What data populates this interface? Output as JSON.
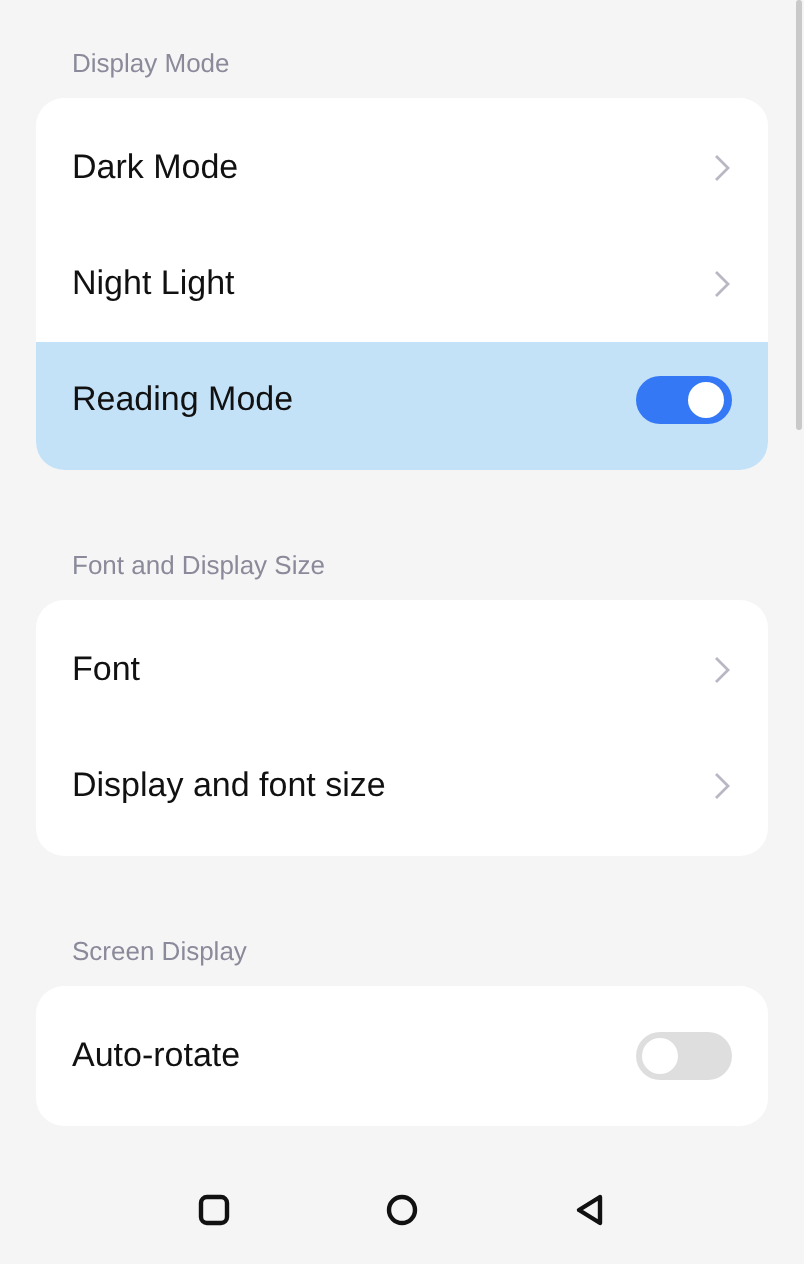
{
  "sections": [
    {
      "title": "Display Mode",
      "rows": [
        {
          "label": "Dark Mode",
          "kind": "link",
          "highlighted": false
        },
        {
          "label": "Night Light",
          "kind": "link",
          "highlighted": false
        },
        {
          "label": "Reading Mode",
          "kind": "toggle",
          "on": true,
          "highlighted": true
        }
      ]
    },
    {
      "title": "Font and Display Size",
      "rows": [
        {
          "label": "Font",
          "kind": "link",
          "highlighted": false
        },
        {
          "label": "Display and font size",
          "kind": "link",
          "highlighted": false
        }
      ]
    },
    {
      "title": "Screen Display",
      "rows": [
        {
          "label": "Auto-rotate",
          "kind": "toggle",
          "on": false,
          "highlighted": false
        }
      ]
    }
  ]
}
